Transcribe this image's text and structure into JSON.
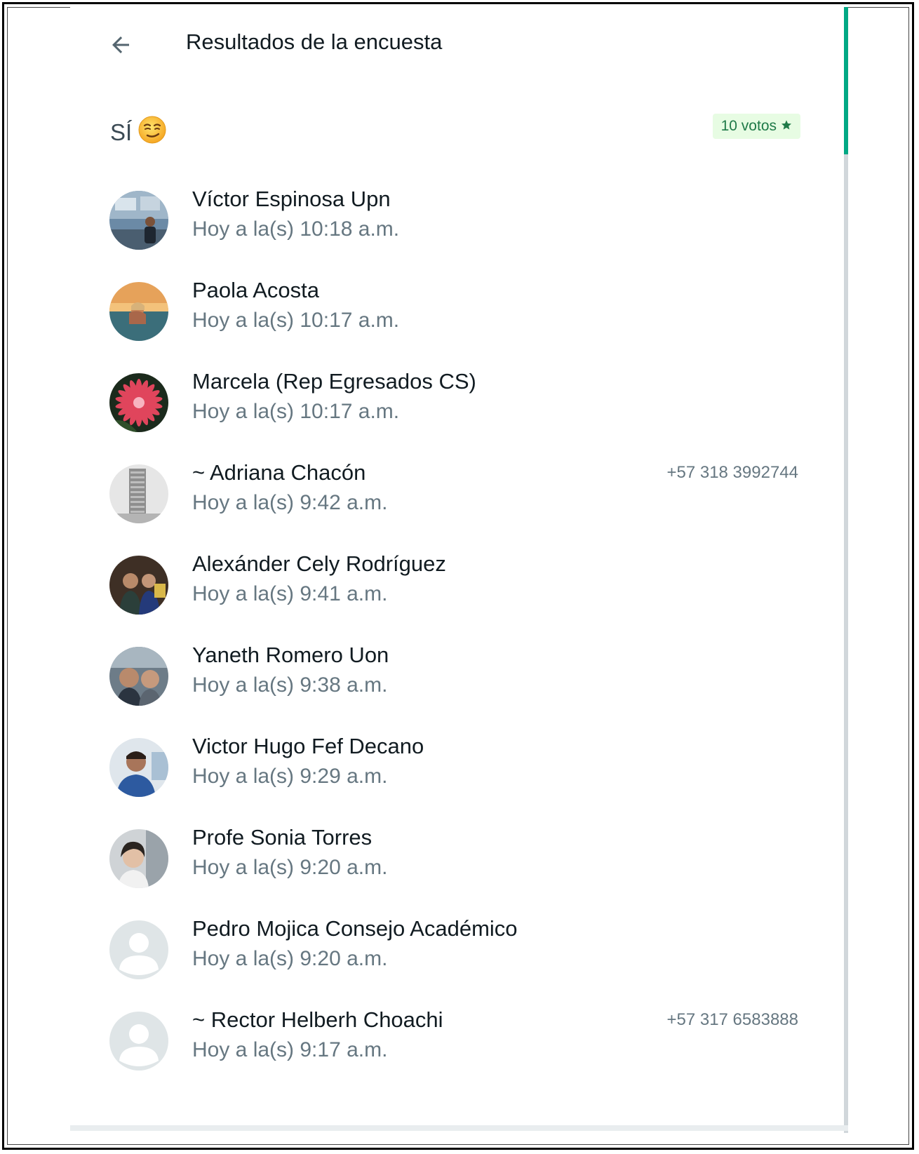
{
  "header": {
    "title": "Resultados de la encuesta",
    "back_icon": "arrow-left-icon"
  },
  "option": {
    "label": "SÍ",
    "emoji": "😏",
    "votes": "10 votos",
    "star_icon": "star-icon",
    "badge_color": "#e7fce3"
  },
  "accent_color": "#00a884",
  "voters": [
    {
      "name": "Víctor Espinosa Upn",
      "time": "Hoy a la(s) 10:18 a.m.",
      "phone": "",
      "avatar": "photo-presenter"
    },
    {
      "name": "Paola Acosta",
      "time": "Hoy a la(s) 10:17 a.m.",
      "phone": "",
      "avatar": "photo-beach"
    },
    {
      "name": "Marcela (Rep Egresados CS)",
      "time": "Hoy a la(s) 10:17 a.m.",
      "phone": "",
      "avatar": "photo-flower"
    },
    {
      "name": "~ Adriana Chacón",
      "time": "Hoy a la(s) 9:42 a.m.",
      "phone": "+57 318 3992744",
      "avatar": "photo-building"
    },
    {
      "name": "Alexánder Cely Rodríguez",
      "time": "Hoy a la(s) 9:41 a.m.",
      "phone": "",
      "avatar": "photo-couple"
    },
    {
      "name": "Yaneth Romero Uon",
      "time": "Hoy a la(s) 9:38 a.m.",
      "phone": "",
      "avatar": "photo-selfie"
    },
    {
      "name": "Victor Hugo Fef Decano",
      "time": "Hoy a la(s) 9:29 a.m.",
      "phone": "",
      "avatar": "photo-portrait"
    },
    {
      "name": "Profe Sonia Torres",
      "time": "Hoy a la(s) 9:20 a.m.",
      "phone": "",
      "avatar": "photo-woman"
    },
    {
      "name": "Pedro Mojica Consejo Académico",
      "time": "Hoy a la(s) 9:20 a.m.",
      "phone": "",
      "avatar": "default-avatar"
    },
    {
      "name": "~ Rector Helberh Choachi",
      "time": "Hoy a la(s) 9:17 a.m.",
      "phone": "+57 317 6583888",
      "avatar": "default-avatar"
    }
  ]
}
